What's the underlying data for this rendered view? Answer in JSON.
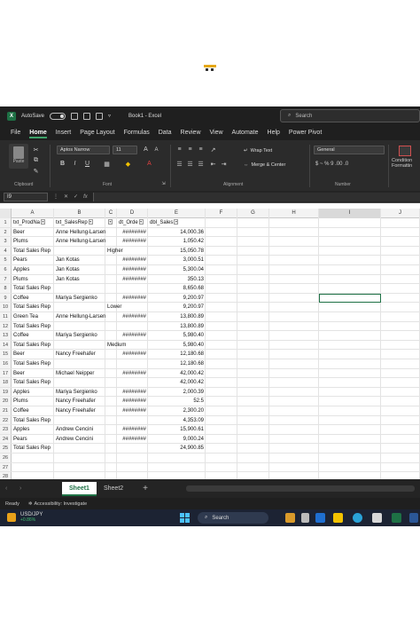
{
  "titlebar": {
    "autosave_label": "AutoSave",
    "autosave_state": "off",
    "workbook_title": "Book1 - Excel",
    "search_placeholder": "Search"
  },
  "menu": {
    "tabs": [
      "File",
      "Home",
      "Insert",
      "Page Layout",
      "Formulas",
      "Data",
      "Review",
      "View",
      "Automate",
      "Help",
      "Power Pivot"
    ],
    "active": "Home"
  },
  "ribbon": {
    "paste_label": "Paste",
    "clipboard_label": "Clipboard",
    "font_name": "Aptos Narrow",
    "font_size": "11",
    "font_label": "Font",
    "wrap_text_label": "Wrap Text",
    "merge_center_label": "Merge & Center",
    "alignment_label": "Alignment",
    "number_format": "General",
    "number_label": "Number",
    "number_symbols": "$  ~  %  9  .00  .0",
    "conditional_label_1": "Condition",
    "conditional_label_2": "Formattin"
  },
  "formula_bar": {
    "name_box": "I9",
    "fx": "fx"
  },
  "grid": {
    "columns": [
      "A",
      "B",
      "C",
      "D",
      "E",
      "F",
      "G",
      "H",
      "I",
      "J"
    ],
    "selected_column": "I",
    "headers": {
      "A": "txt_ProdNa",
      "B": "txt_SalesRep",
      "D": "dt_Orde",
      "E": "dbl_Sales"
    },
    "rows": [
      {
        "n": "1",
        "a": "",
        "b": "",
        "c": "",
        "d": "",
        "e": ""
      },
      {
        "n": "2",
        "a": "Beer",
        "b": "Anne Hellung-Larsen",
        "c": "",
        "d": "########",
        "e": "14,000.36"
      },
      {
        "n": "3",
        "a": "Plums",
        "b": "Anne Hellung-Larsen",
        "c": "",
        "d": "########",
        "e": "1,050.42"
      },
      {
        "n": "4",
        "a": "Total Sales Rep",
        "b": "",
        "c": "Higher",
        "d": "",
        "e": "15,050.78"
      },
      {
        "n": "5",
        "a": "Pears",
        "b": "Jan Kotas",
        "c": "",
        "d": "########",
        "e": "3,000.51"
      },
      {
        "n": "6",
        "a": "Apples",
        "b": "Jan Kotas",
        "c": "",
        "d": "########",
        "e": "5,300.04"
      },
      {
        "n": "7",
        "a": "Plums",
        "b": "Jan Kotas",
        "c": "",
        "d": "########",
        "e": "350.13"
      },
      {
        "n": "8",
        "a": "Total Sales Rep",
        "b": "",
        "c": "",
        "d": "",
        "e": "8,650.68"
      },
      {
        "n": "9",
        "a": "Coffee",
        "b": "Mariya Sergienko",
        "c": "",
        "d": "########",
        "e": "9,200.97"
      },
      {
        "n": "10",
        "a": "Total Sales Rep",
        "b": "",
        "c": "Lower",
        "d": "",
        "e": "9,200.97"
      },
      {
        "n": "11",
        "a": "Green Tea",
        "b": "Anne Hellung-Larsen",
        "c": "",
        "d": "########",
        "e": "13,800.89"
      },
      {
        "n": "12",
        "a": "Total Sales Rep",
        "b": "",
        "c": "",
        "d": "",
        "e": "13,800.89"
      },
      {
        "n": "13",
        "a": "Coffee",
        "b": "Mariya Sergienko",
        "c": "",
        "d": "########",
        "e": "5,980.40"
      },
      {
        "n": "14",
        "a": "Total Sales Rep",
        "b": "",
        "c": "Medium",
        "d": "",
        "e": "5,980.40"
      },
      {
        "n": "15",
        "a": "Beer",
        "b": "Nancy Freehafer",
        "c": "",
        "d": "########",
        "e": "12,180.68"
      },
      {
        "n": "16",
        "a": "Total Sales Rep",
        "b": "",
        "c": "",
        "d": "",
        "e": "12,180.68"
      },
      {
        "n": "17",
        "a": "Beer",
        "b": "Michael Neipper",
        "c": "",
        "d": "########",
        "e": "42,000.42"
      },
      {
        "n": "18",
        "a": "Total Sales Rep",
        "b": "",
        "c": "",
        "d": "",
        "e": "42,000.42"
      },
      {
        "n": "19",
        "a": "Apples",
        "b": "Mariya Sergienko",
        "c": "",
        "d": "########",
        "e": "2,000.39"
      },
      {
        "n": "20",
        "a": "Plums",
        "b": "Nancy Freehafer",
        "c": "",
        "d": "########",
        "e": "52.5"
      },
      {
        "n": "21",
        "a": "Coffee",
        "b": "Nancy Freehafer",
        "c": "",
        "d": "########",
        "e": "2,300.20"
      },
      {
        "n": "22",
        "a": "Total Sales Rep",
        "b": "",
        "c": "",
        "d": "",
        "e": "4,353.09"
      },
      {
        "n": "23",
        "a": "Apples",
        "b": "Andrew Cencini",
        "c": "",
        "d": "########",
        "e": "15,900.61"
      },
      {
        "n": "24",
        "a": "Pears",
        "b": "Andrew Cencini",
        "c": "",
        "d": "########",
        "e": "9,000.24"
      },
      {
        "n": "25",
        "a": "Total Sales Rep",
        "b": "",
        "c": "",
        "d": "",
        "e": "24,900.85"
      },
      {
        "n": "26",
        "a": "",
        "b": "",
        "c": "",
        "d": "",
        "e": ""
      },
      {
        "n": "27",
        "a": "",
        "b": "",
        "c": "",
        "d": "",
        "e": ""
      },
      {
        "n": "28",
        "a": "",
        "b": "",
        "c": "",
        "d": "",
        "e": ""
      }
    ]
  },
  "sheets": {
    "tabs": [
      "Sheet1",
      "Sheet2"
    ],
    "active": "Sheet1",
    "add": "+"
  },
  "statusbar": {
    "ready": "Ready",
    "accessibility": "Accessibility: Investigate"
  },
  "taskbar": {
    "ticker": "USD/JPY",
    "change": "+0.86%",
    "search_label": "Search"
  },
  "colors": {
    "excel_green": "#1e7145",
    "ribbon_dark": "#2b2b2b",
    "windows_blue": "#4cc2ff"
  }
}
